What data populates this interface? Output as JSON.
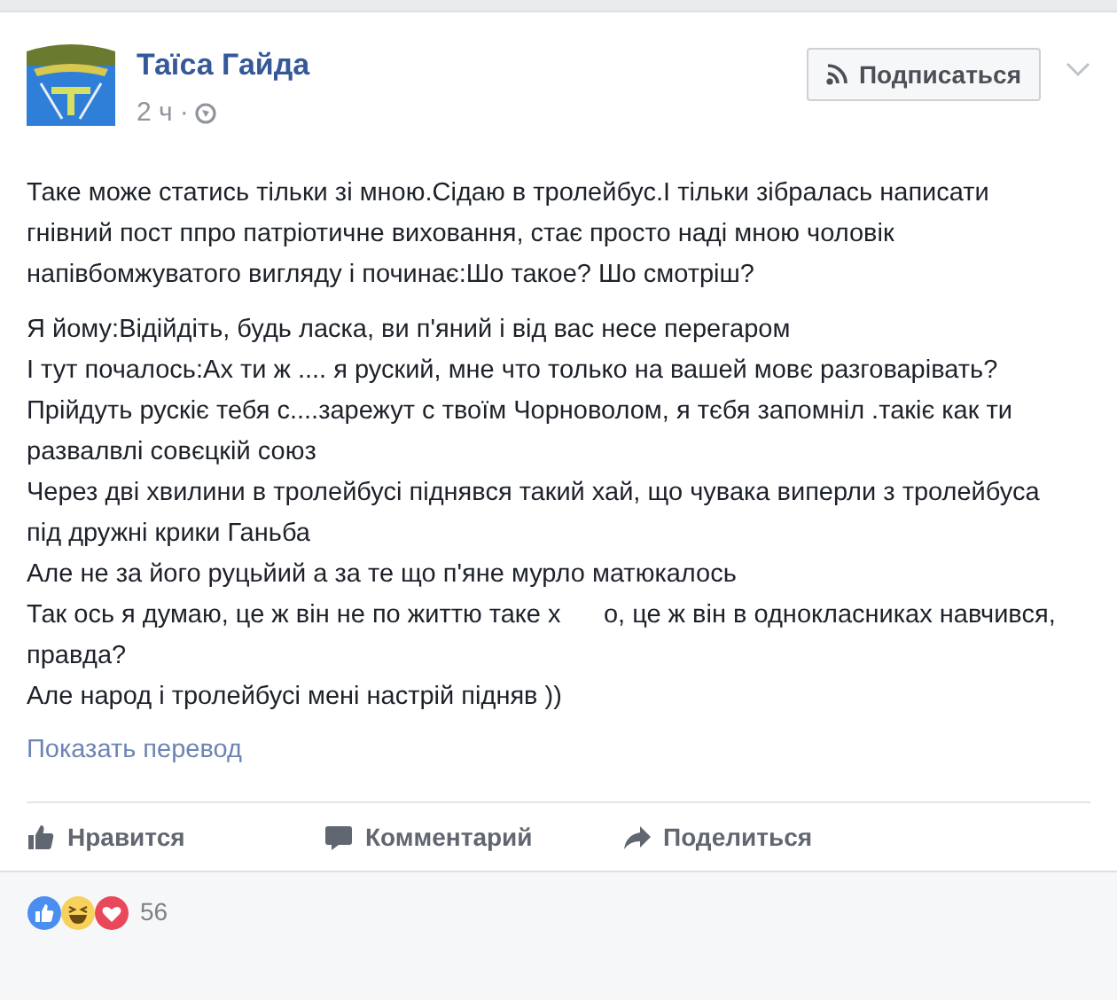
{
  "post": {
    "author": "Таїса Гайда",
    "time": "2 ч",
    "separator": "·",
    "follow_button": "Подписаться",
    "text_blocks": [
      {
        "lines": [
          "Таке може статись тільки зі мною.Сідаю в тролейбус.І тільки зібралась написати гнівний пост ппро патріотичне виховання, стає просто наді мною чоловік напівбомжуватого вигляду і починає:Шо такое? Шо смотріш?"
        ]
      },
      {
        "lines": [
          "Я йому:Відійдіть, будь ласка, ви п'яний і від вас несе перегаром",
          "І тут почалось:Ах ти ж .... я руский, мне что только на вашей мовє разговарівать?Прійдуть рускіє тебя с....зарежут с твоїм Чорноволом, я тєбя запомніл .такіє как ти развалвлі совєцкій союз",
          "Через дві хвилини в тролейбусі піднявся такий хай, що чувака виперли з тролейбуса під дружні крики Ганьба",
          "Але не за його руцьйий а за те що п'яне мурло матюкалось",
          "Так ось я думаю, це ж він не по життю таке х      о, це ж він в однокласниках навчився, правда?",
          "Але народ і тролейбусі мені настрій підняв ))"
        ]
      }
    ],
    "translate_link": "Показать перевод"
  },
  "actions": [
    {
      "kind": "like",
      "label": "Нравится"
    },
    {
      "kind": "comment",
      "label": "Комментарий"
    },
    {
      "kind": "share",
      "label": "Поделиться"
    }
  ],
  "reactions": {
    "count": "56"
  }
}
